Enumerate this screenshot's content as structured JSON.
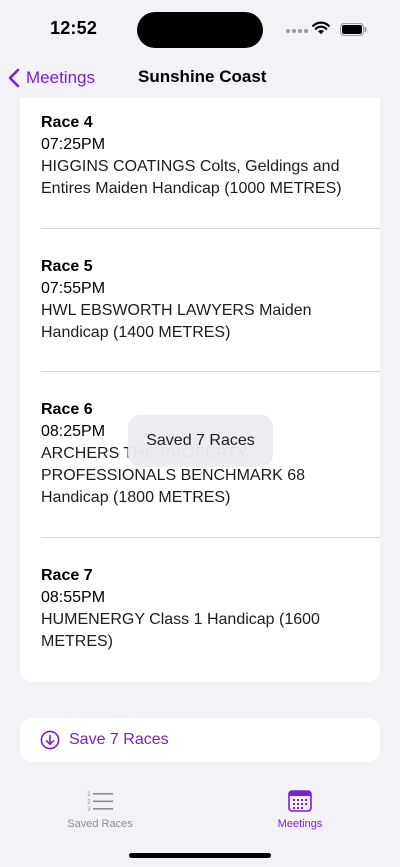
{
  "status_bar": {
    "time": "12:52"
  },
  "nav": {
    "back_label": "Meetings",
    "title": "Sunshine Coast"
  },
  "races": [
    {
      "title": "Race 4",
      "time": "07:25PM",
      "name": "HIGGINS COATINGS Colts, Geldings and Entires Maiden Handicap (1000 METRES)"
    },
    {
      "title": "Race 5",
      "time": "07:55PM",
      "name": "HWL EBSWORTH LAWYERS Maiden Handicap (1400 METRES)"
    },
    {
      "title": "Race 6",
      "time": "08:25PM",
      "name": "ARCHERS THE PROPERTY PROFESSIONALS BENCHMARK 68 Handicap (1800 METRES)"
    },
    {
      "title": "Race 7",
      "time": "08:55PM",
      "name": "HUMENERGY Class 1 Handicap (1600 METRES)"
    }
  ],
  "toast": {
    "message": "Saved 7 Races"
  },
  "save_button": {
    "label": "Save 7 Races"
  },
  "tabs": [
    {
      "label": "Saved Races",
      "icon": "list-icon",
      "selected": false
    },
    {
      "label": "Meetings",
      "icon": "calendar-icon",
      "selected": true
    }
  ],
  "colors": {
    "accent": "#7a1fd6",
    "background": "#f2f2f7",
    "inactive_tab": "#8e8e93"
  }
}
